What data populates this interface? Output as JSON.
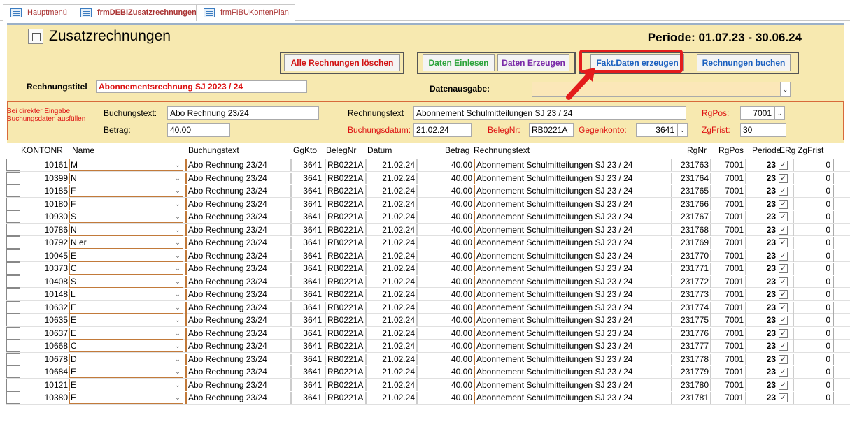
{
  "tabs": [
    {
      "label": "Hauptmenü"
    },
    {
      "label": "frmDEBIZusatzrechnungen"
    },
    {
      "label": "frmFIBUKontenPlan"
    }
  ],
  "header": {
    "title": "Zusatzrechnungen",
    "periode": "Periode: 01.07.23 - 30.06.24"
  },
  "buttons": {
    "alle_loeschen": "Alle Rechnungen löschen",
    "daten_einlesen": "Daten Einlesen",
    "daten_erzeugen": "Daten Erzeugen",
    "fakt_daten": "Fakt.Daten erzeugen",
    "rechnungen_buchen": "Rechnungen buchen"
  },
  "colors": {
    "highlight": "#e31c1c",
    "loeschen": "#d11111",
    "einlesen": "#2aa33a",
    "erzeugen": "#7a2aa8",
    "fakt": "#1a5fbf",
    "buchen": "#1a5fbf"
  },
  "rechnungstitel": {
    "label": "Rechnungstitel",
    "value": "Abonnementsrechnung SJ 2023 / 24"
  },
  "datenausgabe": {
    "label": "Datenausgabe:",
    "value": ""
  },
  "direct_input": {
    "hint": "Bei direkter Eingabe Buchungsdaten ausfüllen",
    "buchungstext_label": "Buchungstext:",
    "buchungstext_value": "Abo Rechnung 23/24",
    "betrag_label": "Betrag:",
    "betrag_value": "40.00",
    "rechnungstext_label": "Rechnungstext",
    "rechnungstext_value": "Abonnement Schulmitteilungen SJ 23 / 24",
    "buchungsdatum_label": "Buchungsdatum:",
    "buchungsdatum_value": "21.02.24",
    "belegnr_label": "BelegNr:",
    "belegnr_value": "RB0221A",
    "gegenkonto_label": "Gegenkonto:",
    "gegenkonto_value": "3641",
    "rgpos_label": "RgPos:",
    "rgpos_value": "7001",
    "zgfrist_label": "ZgFrist:",
    "zgfrist_value": "30"
  },
  "columns": [
    "KONTONR",
    "Name",
    "Buchungstext",
    "GgKto",
    "BelegNr",
    "Datum",
    "Betrag",
    "Rechnungstext",
    "RgNr",
    "RgPos",
    "Periode",
    "ERg",
    "ZgFrist"
  ],
  "row_defaults": {
    "buchungstext": "Abo Rechnung 23/24",
    "ggkto": "3641",
    "belegnr": "RB0221A",
    "datum": "21.02.24",
    "betrag": "40.00",
    "rechnungstext": "Abonnement Schulmitteilungen SJ 23 / 24",
    "rgpos": "7001",
    "periode": "23",
    "erg": true,
    "zgfrist": "0"
  },
  "rows": [
    {
      "kontonr": "10161",
      "name": "M",
      "rgnr": "231763"
    },
    {
      "kontonr": "10399",
      "name": "N",
      "rgnr": "231764"
    },
    {
      "kontonr": "10185",
      "name": "F",
      "rgnr": "231765"
    },
    {
      "kontonr": "10180",
      "name": "F",
      "rgnr": "231766"
    },
    {
      "kontonr": "10930",
      "name": "S",
      "rgnr": "231767"
    },
    {
      "kontonr": "10786",
      "name": "N",
      "rgnr": "231768"
    },
    {
      "kontonr": "10792",
      "name": "N                         er",
      "rgnr": "231769"
    },
    {
      "kontonr": "10045",
      "name": "E",
      "rgnr": "231770"
    },
    {
      "kontonr": "10373",
      "name": "C",
      "rgnr": "231771"
    },
    {
      "kontonr": "10408",
      "name": "S",
      "rgnr": "231772"
    },
    {
      "kontonr": "10148",
      "name": "L",
      "rgnr": "231773"
    },
    {
      "kontonr": "10632",
      "name": "E",
      "rgnr": "231774"
    },
    {
      "kontonr": "10635",
      "name": "E",
      "rgnr": "231775"
    },
    {
      "kontonr": "10637",
      "name": "E",
      "rgnr": "231776"
    },
    {
      "kontonr": "10668",
      "name": "C",
      "rgnr": "231777"
    },
    {
      "kontonr": "10678",
      "name": "D",
      "rgnr": "231778"
    },
    {
      "kontonr": "10684",
      "name": "E",
      "rgnr": "231779"
    },
    {
      "kontonr": "10121",
      "name": "E",
      "rgnr": "231780"
    },
    {
      "kontonr": "10380",
      "name": "E",
      "rgnr": "231781"
    }
  ]
}
